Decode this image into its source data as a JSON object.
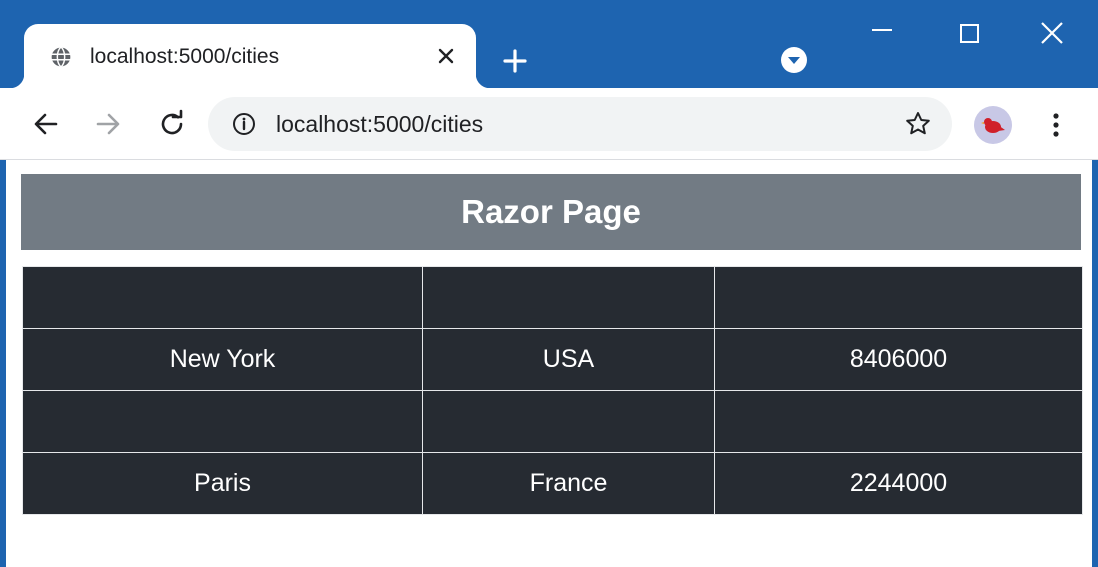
{
  "browser": {
    "tab": {
      "favicon": "globe-icon",
      "title": "localhost:5000/cities",
      "close": "close-icon"
    },
    "new_tab": "plus-icon",
    "tab_search": "chevron-down-icon",
    "window_controls": [
      "minimize-icon",
      "maximize-icon",
      "close-icon"
    ],
    "colors": {
      "titlebar": "#1e64b0",
      "omnibox": "#f1f3f4"
    }
  },
  "toolbar": {
    "url": "localhost:5000/cities",
    "icons": [
      "back-arrow-icon",
      "forward-arrow-icon",
      "reload-icon",
      "info-icon",
      "star-icon",
      "profile-avatar",
      "kebab-menu-icon"
    ]
  },
  "page": {
    "header": "Razor Page",
    "header_bg": "#727b84",
    "table_bg": "#262b32",
    "rows": [
      {
        "city": "",
        "country": "",
        "population": ""
      },
      {
        "city": "New York",
        "country": "USA",
        "population": "8406000"
      },
      {
        "city": "",
        "country": "",
        "population": ""
      },
      {
        "city": "Paris",
        "country": "France",
        "population": "2244000"
      }
    ]
  }
}
